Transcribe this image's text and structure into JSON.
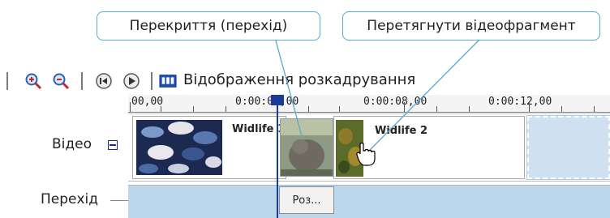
{
  "callouts": {
    "overlap": "Перекриття (перехід)",
    "drag_clip": "Перетягнути відеофрагмент"
  },
  "toolbar": {
    "storyboard_label": "Відображення розкадрування",
    "icons": [
      "zoom-in-icon",
      "zoom-out-icon",
      "rewind-icon",
      "play-icon",
      "storyboard-icon"
    ]
  },
  "ruler": {
    "ticks": [
      "00,00",
      "0:00:04,00",
      "0:00:08,00",
      "0:00:12,00"
    ]
  },
  "tracks": {
    "video_label": "Відео",
    "transition_label": "Перехід"
  },
  "clips": {
    "clip1_title": "Widlife 1",
    "clip2_title": "Widlife 2"
  },
  "transition": {
    "label": "Роз..."
  },
  "colors": {
    "callout_border": "#5aa9cf",
    "playhead": "#1b3a9a",
    "transition_track": "#bcd6ec"
  }
}
